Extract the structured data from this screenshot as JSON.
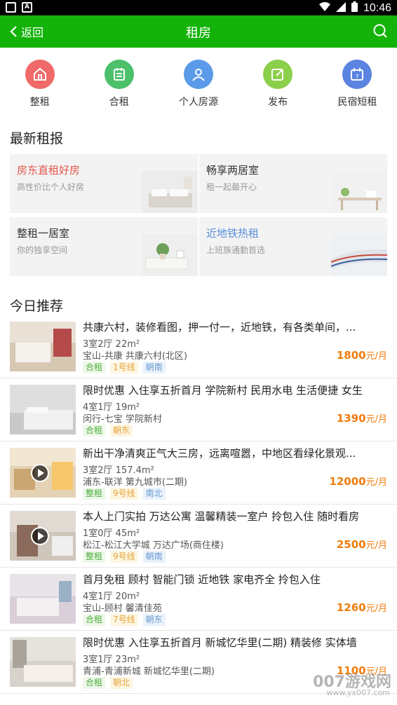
{
  "status_bar": {
    "time": "10:46"
  },
  "app_bar": {
    "back_label": "返回",
    "title": "租房"
  },
  "categories": [
    {
      "label": "整租",
      "icon": "house-icon",
      "color": "#f06a6a"
    },
    {
      "label": "合租",
      "icon": "building-icon",
      "color": "#4cc06b"
    },
    {
      "label": "个人房源",
      "icon": "person-icon",
      "color": "#5b9ae8"
    },
    {
      "label": "发布",
      "icon": "edit-icon",
      "color": "#8ccf4b"
    },
    {
      "label": "民宿短租",
      "icon": "calendar-icon",
      "color": "#5b83e0"
    }
  ],
  "sections": {
    "news": "最新租报",
    "recommend": "今日推荐"
  },
  "promos": [
    {
      "title": "房东直租好房",
      "sub": "高性价比个人好房",
      "title_color": "#e2574c"
    },
    {
      "title": "畅享两居室",
      "sub": "租一起最开心",
      "title_color": "#333333"
    },
    {
      "title": "整租一居室",
      "sub": "你的独享空间",
      "title_color": "#333333"
    },
    {
      "title": "近地铁热租",
      "sub": "上班族通勤首选",
      "title_color": "#5b8fd6"
    }
  ],
  "listings": [
    {
      "title": "共康六村，装修看图，押一付一，近地铁，有各类单间，...",
      "spec": "3室2厅  22m²",
      "location": "宝山-共康  共康六村(北区)",
      "tags": [
        "合租",
        "1号线",
        "朝南"
      ],
      "price": "1800",
      "unit": "元/月",
      "video": false
    },
    {
      "title": "限时优惠 入住享五折首月 学院新村 民用水电 生活便捷 女生",
      "spec": "4室1厅  19m²",
      "location": "闵行-七宝  学院新村",
      "tags": [
        "合租",
        "朝东"
      ],
      "price": "1390",
      "unit": "元/月",
      "video": false
    },
    {
      "title": "新出干净清爽正气大三房，远离喧嚣，中地区看绿化景观...",
      "spec": "3室2厅  157.4m²",
      "location": "浦东-联洋  第九城市(二期)",
      "tags": [
        "整租",
        "9号线",
        "南北"
      ],
      "price": "12000",
      "unit": "元/月",
      "video": true
    },
    {
      "title": "本人上门实拍 万达公寓 温馨精装一室户 拎包入住 随时看房",
      "spec": "1室0厅  45m²",
      "location": "松江-松江大学城  万达广场(商住楼)",
      "tags": [
        "整租",
        "9号线",
        "朝南"
      ],
      "price": "2500",
      "unit": "元/月",
      "video": true
    },
    {
      "title": "首月免租 顾村 智能门锁 近地铁 家电齐全 拎包入住",
      "spec": "4室1厅  20m²",
      "location": "宝山-顾村  馨清佳苑",
      "tags": [
        "合租",
        "7号线",
        "朝东"
      ],
      "price": "1260",
      "unit": "元/月",
      "video": false
    },
    {
      "title": "限时优惠 入住享五折首月 新城忆华里(二期) 精装修 实体墙",
      "spec": "3室1厅  23m²",
      "location": "青浦-青浦新城  新城忆华里(二期)",
      "tags": [
        "合租",
        "朝北"
      ],
      "price": "1100",
      "unit": "元/月",
      "video": false
    }
  ],
  "watermark": {
    "main": "007游戏网",
    "sub": "www.yx007.com"
  }
}
